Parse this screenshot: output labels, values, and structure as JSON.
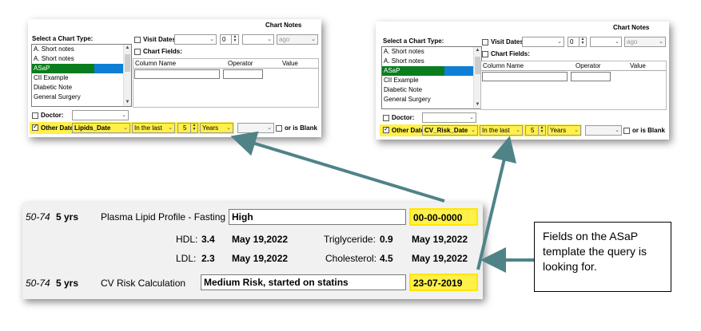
{
  "left_panel": {
    "title": "Chart Notes",
    "select_chart_type_label": "Select a Chart Type:",
    "chart_types": [
      "A. Short notes",
      "A. Short notes",
      "ASaP",
      "CII Example",
      "Diabetic Note",
      "General Surgery"
    ],
    "selected_chart_type": "ASaP",
    "visit_dates_label": "Visit Dates",
    "visit_dates_number": "0",
    "visit_dates_ago": "ago",
    "chart_fields_label": "Chart Fields:",
    "columns": [
      "Column Name",
      "Operator",
      "Value"
    ],
    "doctor_label": "Doctor:",
    "other_date_label": "Other Date",
    "other_date_field": "Lipids_Date",
    "period": "In the last",
    "count": "5",
    "unit": "Years",
    "or_is_blank": "or is Blank"
  },
  "right_panel": {
    "title": "Chart Notes",
    "select_chart_type_label": "Select a Chart Type:",
    "chart_types": [
      "A. Short notes",
      "A. Short notes",
      "ASaP",
      "CII Example",
      "Diabetic Note",
      "General Surgery"
    ],
    "selected_chart_type": "ASaP",
    "visit_dates_label": "Visit Dates",
    "visit_dates_number": "0",
    "visit_dates_ago": "ago",
    "chart_fields_label": "Chart Fields:",
    "columns": [
      "Column Name",
      "Operator",
      "Value"
    ],
    "doctor_label": "Doctor:",
    "other_date_label": "Other Date",
    "other_date_field": "CV_Risk_Date",
    "period": "In the last",
    "count": "5",
    "unit": "Years",
    "or_is_blank": "or is Blank"
  },
  "template": {
    "row1": {
      "age": "50-74",
      "freq": "5 yrs",
      "label": "Plasma Lipid Profile - Fasting",
      "value": "High",
      "date": "00-00-0000"
    },
    "hdl": {
      "label": "HDL:",
      "value": "3.4",
      "date": "May 19,2022"
    },
    "triglyceride": {
      "label": "Triglyceride:",
      "value": "0.9",
      "date": "May 19,2022"
    },
    "ldl": {
      "label": "LDL:",
      "value": "2.3",
      "date": "May 19,2022"
    },
    "cholesterol": {
      "label": "Cholesterol:",
      "value": "4.5",
      "date": "May 19,2022"
    },
    "row2": {
      "age": "50-74",
      "freq": "5 yrs",
      "label": "CV Risk Calculation",
      "value": "Medium Risk, started on statins",
      "date": "23-07-2019"
    }
  },
  "callout": {
    "text": "Fields on the ASaP template the query is looking for."
  },
  "colors": {
    "highlight": "#fff04a",
    "arrow": "#4f8388",
    "selection_green": "#0a7d1f",
    "selection_blue": "#0f7fd6"
  }
}
